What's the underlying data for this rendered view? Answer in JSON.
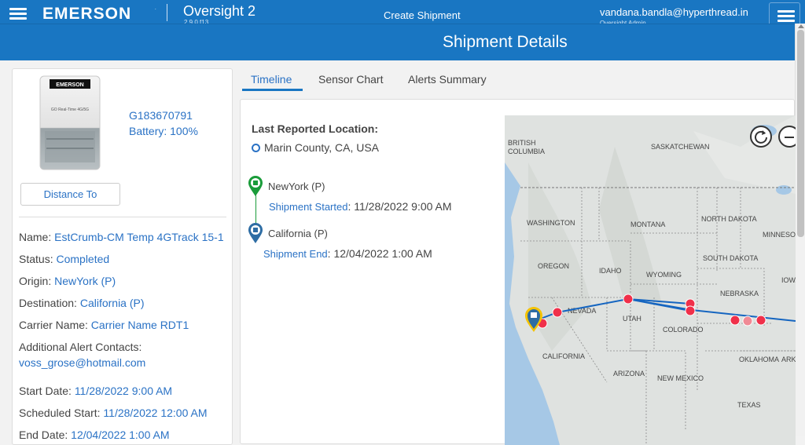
{
  "topbar": {
    "brand": "EMERSON",
    "brand_tm": ".",
    "app_name": "Oversight 2",
    "app_version": "2.9.0.f13",
    "create_shipment": "Create Shipment",
    "user_email": "vandana.bandla@hyperthread.in",
    "user_sub": "Oversight Admin"
  },
  "header": {
    "title": "Shipment Details"
  },
  "device": {
    "image_logo": "EMERSON",
    "image_text": "GO Real-Time 4G/5G",
    "id": "G183670791",
    "battery": "Battery: 100%",
    "distance_btn": "Distance To"
  },
  "details": [
    {
      "label": "Name: ",
      "value": "EstCrumb-CM Temp 4GTrack 15-1"
    },
    {
      "label": "Status: ",
      "value": "Completed"
    },
    {
      "label": "Origin: ",
      "value": "NewYork (P)"
    },
    {
      "label": "Destination: ",
      "value": "California (P)"
    },
    {
      "label": "Carrier Name: ",
      "value": "Carrier Name RDT1"
    },
    {
      "label": "Additional Alert Contacts:",
      "value": "voss_grose@hotmail.com"
    },
    {
      "label": "Start Date: ",
      "value": "11/28/2022 9:00 AM"
    },
    {
      "label": "Scheduled Start: ",
      "value": "11/28/2022 12:00 AM"
    },
    {
      "label": "End Date: ",
      "value": "12/04/2022 1:00 AM"
    }
  ],
  "tabs": [
    "Timeline",
    "Sensor Chart",
    "Alerts Summary"
  ],
  "timeline": {
    "last_loc_title": "Last Reported Location:",
    "last_loc": "Marin County, CA, USA",
    "events": [
      {
        "place": "NewYork (P)",
        "key": "Shipment Started",
        "value": ": 11/28/2022 9:00 AM",
        "pin_color": "#1a9c3a",
        "icon": "building-icon"
      },
      {
        "place": "California (P)",
        "key": "Shipment End",
        "value": ": 12/04/2022 1:00 AM",
        "pin_color": "#2e6da4",
        "icon": "building-icon"
      }
    ]
  },
  "map": {
    "labels": [
      "BRITISH COLUMBIA",
      "SASKATCHEWAN",
      "WASHINGTON",
      "MONTANA",
      "NORTH DAKOTA",
      "MINNESOTA",
      "OREGON",
      "IDAHO",
      "SOUTH DAKOTA",
      "WYOMING",
      "IOWA",
      "NEBRASKA",
      "NEVADA",
      "UTAH",
      "COLORADO",
      "CALIFORNIA",
      "OKLAHOMA",
      "ARIZONA",
      "NEW MEXICO",
      "ARKANSAS",
      "TEXAS"
    ],
    "route_color": "#1565c0",
    "marker_color": "#f0304a",
    "controls": [
      "refresh-icon",
      "zoom-out-icon"
    ]
  }
}
